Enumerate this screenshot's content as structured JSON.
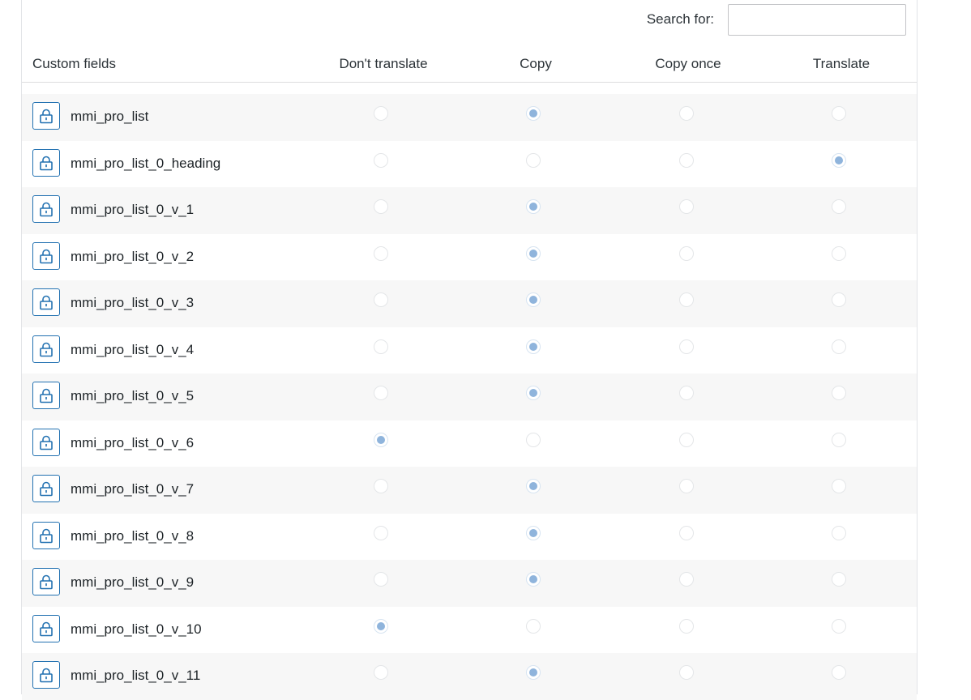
{
  "search": {
    "label": "Search for:",
    "value": "",
    "placeholder": ""
  },
  "columns": {
    "name": "Custom fields",
    "options": [
      "Don't translate",
      "Copy",
      "Copy once",
      "Translate"
    ]
  },
  "fields": [
    {
      "name": "mmi_pro_list",
      "selected": "Copy"
    },
    {
      "name": "mmi_pro_list_0_heading",
      "selected": "Translate"
    },
    {
      "name": "mmi_pro_list_0_v_1",
      "selected": "Copy"
    },
    {
      "name": "mmi_pro_list_0_v_2",
      "selected": "Copy"
    },
    {
      "name": "mmi_pro_list_0_v_3",
      "selected": "Copy"
    },
    {
      "name": "mmi_pro_list_0_v_4",
      "selected": "Copy"
    },
    {
      "name": "mmi_pro_list_0_v_5",
      "selected": "Copy"
    },
    {
      "name": "mmi_pro_list_0_v_6",
      "selected": "Don't translate"
    },
    {
      "name": "mmi_pro_list_0_v_7",
      "selected": "Copy"
    },
    {
      "name": "mmi_pro_list_0_v_8",
      "selected": "Copy"
    },
    {
      "name": "mmi_pro_list_0_v_9",
      "selected": "Copy"
    },
    {
      "name": "mmi_pro_list_0_v_10",
      "selected": "Don't translate"
    },
    {
      "name": "mmi_pro_list_0_v_11",
      "selected": "Copy"
    }
  ],
  "icons": {
    "row_action": "lock-icon"
  },
  "colors": {
    "accent": "#2271b1",
    "radio_checked": "#8fb4dc",
    "row_alt": "#f7f7f7"
  }
}
